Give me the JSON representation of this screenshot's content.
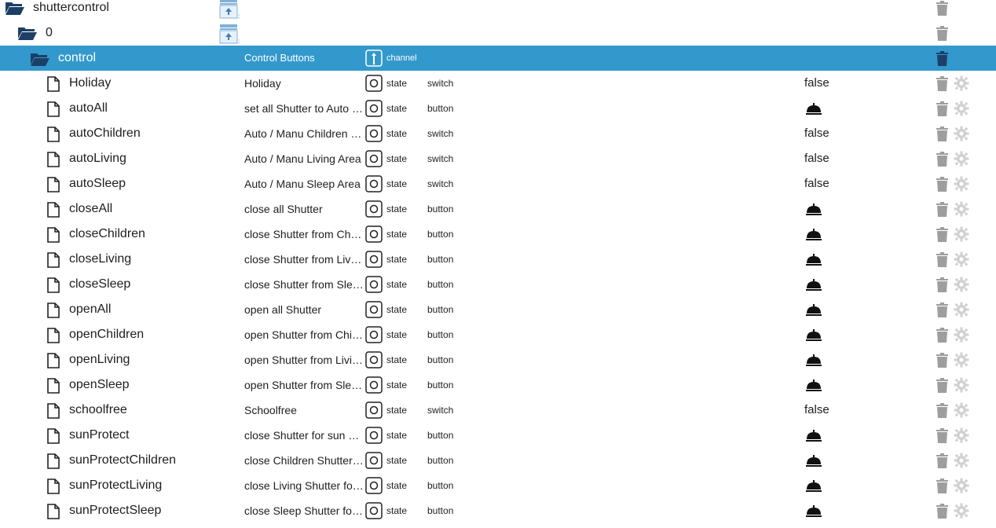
{
  "tree": {
    "root": {
      "name": "shuttercontrol"
    },
    "instance": {
      "name": "0"
    },
    "channel": {
      "name": "control",
      "description": "Control Buttons",
      "type": "channel"
    },
    "states": [
      {
        "name": "Holiday",
        "description": "Holiday",
        "type": "state",
        "role": "switch",
        "value": "false"
      },
      {
        "name": "autoAll",
        "description": "set all Shutter to Auto …",
        "type": "state",
        "role": "button",
        "value": ""
      },
      {
        "name": "autoChildren",
        "description": "Auto / Manu Children …",
        "type": "state",
        "role": "switch",
        "value": "false"
      },
      {
        "name": "autoLiving",
        "description": "Auto / Manu Living Area",
        "type": "state",
        "role": "switch",
        "value": "false"
      },
      {
        "name": "autoSleep",
        "description": "Auto / Manu Sleep Area",
        "type": "state",
        "role": "switch",
        "value": "false"
      },
      {
        "name": "closeAll",
        "description": "close all Shutter",
        "type": "state",
        "role": "button",
        "value": ""
      },
      {
        "name": "closeChildren",
        "description": "close Shutter from Chil…",
        "type": "state",
        "role": "button",
        "value": ""
      },
      {
        "name": "closeLiving",
        "description": "close Shutter from Livi…",
        "type": "state",
        "role": "button",
        "value": ""
      },
      {
        "name": "closeSleep",
        "description": "close Shutter from Sle…",
        "type": "state",
        "role": "button",
        "value": ""
      },
      {
        "name": "openAll",
        "description": "open all Shutter",
        "type": "state",
        "role": "button",
        "value": ""
      },
      {
        "name": "openChildren",
        "description": "open Shutter from Chil…",
        "type": "state",
        "role": "button",
        "value": ""
      },
      {
        "name": "openLiving",
        "description": "open Shutter from Livi…",
        "type": "state",
        "role": "button",
        "value": ""
      },
      {
        "name": "openSleep",
        "description": "open Shutter from Sle…",
        "type": "state",
        "role": "button",
        "value": ""
      },
      {
        "name": "schoolfree",
        "description": "Schoolfree",
        "type": "state",
        "role": "switch",
        "value": "false"
      },
      {
        "name": "sunProtect",
        "description": "close Shutter for sun p…",
        "type": "state",
        "role": "button",
        "value": ""
      },
      {
        "name": "sunProtectChildren",
        "description": "close Children Shutter …",
        "type": "state",
        "role": "button",
        "value": ""
      },
      {
        "name": "sunProtectLiving",
        "description": "close Living Shutter for…",
        "type": "state",
        "role": "button",
        "value": ""
      },
      {
        "name": "sunProtectSleep",
        "description": "close Sleep Shutter for…",
        "type": "state",
        "role": "button",
        "value": ""
      }
    ]
  },
  "colors": {
    "selected_bg": "#3399cc",
    "icon_gray": "#9e9e9e",
    "folder_dark": "#1c3f66"
  }
}
